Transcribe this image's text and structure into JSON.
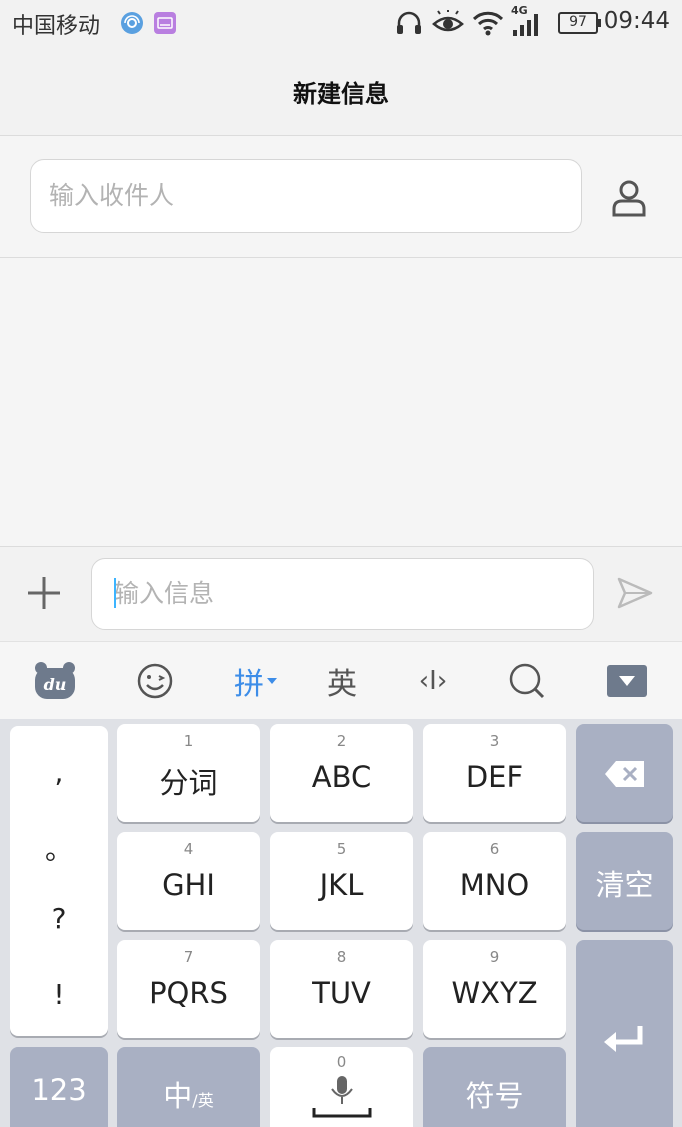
{
  "status_bar": {
    "carrier": "中国移动",
    "network": "4G",
    "battery": "97",
    "time": "09:44"
  },
  "header": {
    "title": "新建信息"
  },
  "recipient": {
    "placeholder": "输入收件人"
  },
  "compose": {
    "placeholder": "输入信息"
  },
  "keyboard": {
    "toolbar": {
      "logo": "du",
      "pinyin_label": "拼",
      "english_label": "英",
      "cursor_label": "‹I›"
    },
    "punctuation": [
      ",",
      "。",
      "?",
      "!"
    ],
    "keys": [
      {
        "num": "1",
        "label": "分词"
      },
      {
        "num": "2",
        "label": "ABC"
      },
      {
        "num": "3",
        "label": "DEF"
      },
      {
        "num": "4",
        "label": "GHI"
      },
      {
        "num": "5",
        "label": "JKL"
      },
      {
        "num": "6",
        "label": "MNO"
      },
      {
        "num": "7",
        "label": "PQRS"
      },
      {
        "num": "8",
        "label": "TUV"
      },
      {
        "num": "9",
        "label": "WXYZ"
      }
    ],
    "clear_label": "清空",
    "numbers_label": "123",
    "lang_main": "中",
    "lang_sub": "/英",
    "space_num": "0",
    "symbols_label": "符号"
  },
  "icons": {
    "status": [
      "vpn-icon",
      "keyboard-status-icon",
      "headphones-icon",
      "eye-icon",
      "wifi-icon",
      "signal-icon",
      "battery-icon"
    ],
    "compose": [
      "contact-icon",
      "plus-icon",
      "send-icon"
    ],
    "keyboard": [
      "baidu-logo-icon",
      "emoji-icon",
      "search-icon",
      "hide-keyboard-icon",
      "backspace-icon",
      "microphone-icon",
      "enter-icon"
    ]
  },
  "colors": {
    "accent": "#3d8de8",
    "dark_key": "#a9b0c3",
    "caret": "#3cb4ff",
    "vpn_badge": "#5aa0e0",
    "keyboard_badge": "#b97fe0"
  }
}
